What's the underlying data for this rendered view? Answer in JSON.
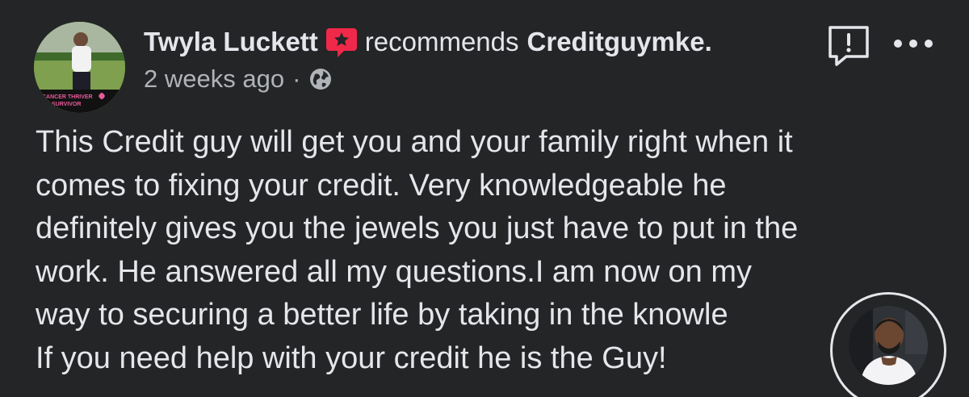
{
  "post": {
    "author": "Twyla Luckett",
    "verb": "recommends",
    "page_name": "Creditguymke.",
    "timestamp": "2 weeks ago",
    "separator": "·",
    "privacy_icon": "globe-icon",
    "recommend_icon": "recommend-badge-icon",
    "avatar_badge_text": "CANCER THRIVER · SURVIVOR",
    "body_lines": [
      "This Credit guy will get you and your family right when it",
      "comes to fixing your credit. Very knowledgeable he",
      "definitely gives you the jewels you just have to put in the",
      "work. He answered all my questions.I am now on my",
      "way to securing a better life by taking in the knowle",
      "If you need help with your credit he is the Guy!"
    ]
  },
  "actions": {
    "report_icon": "report-icon",
    "more_icon": "more-options-icon"
  },
  "colors": {
    "background": "#242526",
    "primary_text": "#e4e6eb",
    "secondary_text": "#b0b3b8",
    "recommend_accent": "#f02849"
  }
}
